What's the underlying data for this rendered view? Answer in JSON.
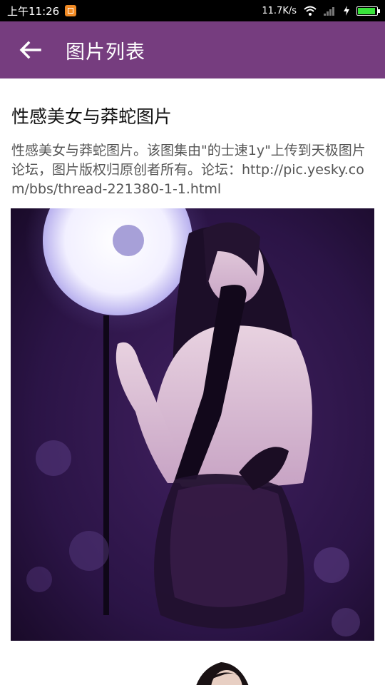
{
  "status_bar": {
    "time": "上午11:26",
    "network_speed": "11.7K/s",
    "icons": [
      "notification-icon",
      "wifi-icon",
      "signal-icon",
      "charging-icon",
      "battery-icon"
    ],
    "battery_color": "#39e33b"
  },
  "app_bar": {
    "title": "图片列表",
    "back_icon": "back-arrow-icon",
    "color": "#763d7f"
  },
  "post": {
    "title": "性感美女与莽蛇图片",
    "description": "性感美女与莽蛇图片。该图集由\"的士速1y\"上传到天极图片论坛，图片版权归原创者所有。论坛：http://pic.yesky.com/bbs/thread-221380-1-1.html"
  }
}
